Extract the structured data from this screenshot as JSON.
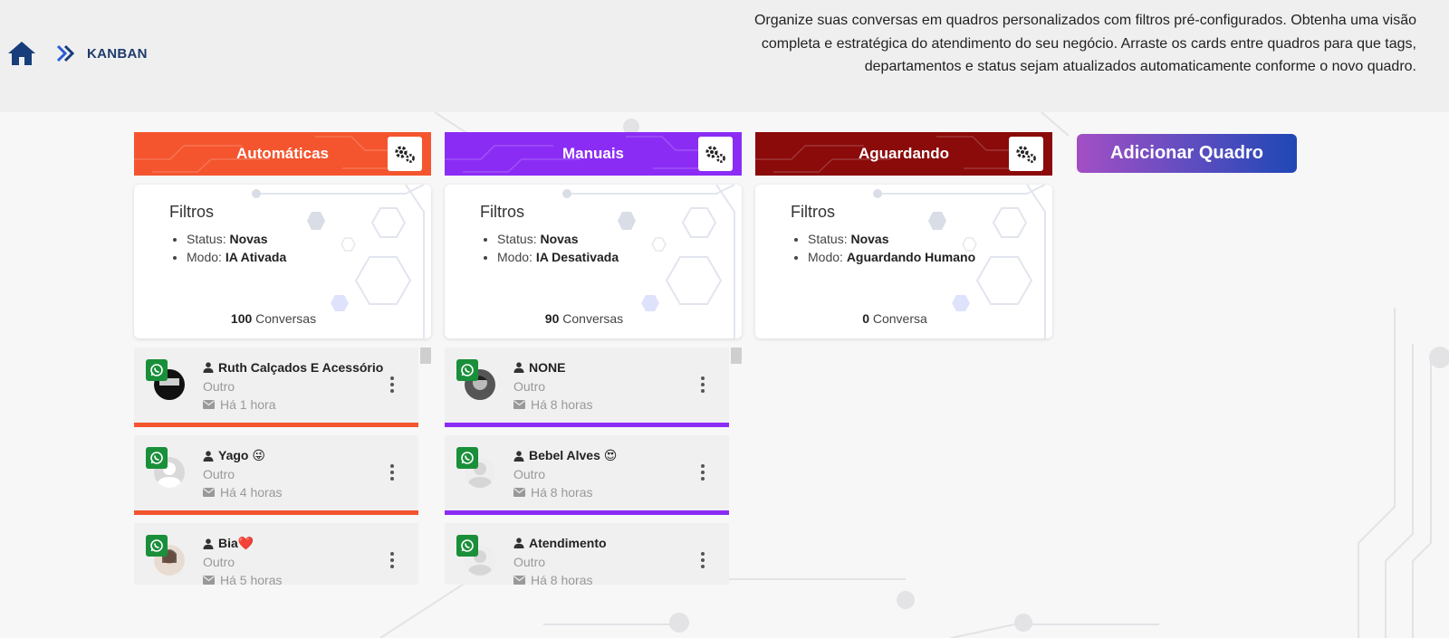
{
  "breadcrumb": {
    "current": "KANBAN"
  },
  "description": "Organize suas conversas em quadros personalizados com filtros pré-configurados. Obtenha uma visão completa e estratégica do atendimento do seu negócio. Arraste os cards entre quadros para que tags, departamentos e status sejam atualizados automaticamente conforme o novo quadro.",
  "add_board_label": "Adicionar Quadro",
  "columns": [
    {
      "title": "Automáticas",
      "color": "#f4552e",
      "filters_title": "Filtros",
      "status_label": "Status: ",
      "status_value": "Novas",
      "mode_label": "Modo: ",
      "mode_value": "IA Ativada",
      "count_value": "100",
      "count_label": " Conversas",
      "cards": [
        {
          "name": "Ruth Calçados E Acessório",
          "sub": "Outro",
          "time": "Há 1 hora"
        },
        {
          "name": "Yago 😜",
          "sub": "Outro",
          "time": "Há 4 horas"
        },
        {
          "name": "Bia❤️",
          "sub": "Outro",
          "time": "Há 5 horas"
        }
      ]
    },
    {
      "title": "Manuais",
      "color": "#8b2cf5",
      "filters_title": "Filtros",
      "status_label": "Status: ",
      "status_value": "Novas",
      "mode_label": "Modo: ",
      "mode_value": "IA Desativada",
      "count_value": "90",
      "count_label": " Conversas",
      "cards": [
        {
          "name": "NONE",
          "sub": "Outro",
          "time": "Há 8 horas"
        },
        {
          "name": "Bebel Alves 😍",
          "sub": "Outro",
          "time": "Há 8 horas"
        },
        {
          "name": "Atendimento",
          "sub": "Outro",
          "time": "Há 8 horas"
        }
      ]
    },
    {
      "title": "Aguardando",
      "color": "#8b0a0a",
      "filters_title": "Filtros",
      "status_label": "Status: ",
      "status_value": "Novas",
      "mode_label": "Modo: ",
      "mode_value": "Aguardando Humano",
      "count_value": "0",
      "count_label": " Conversa",
      "cards": []
    }
  ]
}
